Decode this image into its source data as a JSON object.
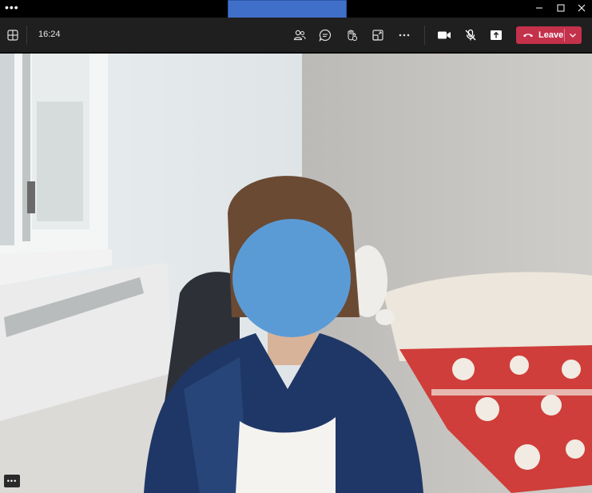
{
  "titlebar": {
    "menu_label": "•••"
  },
  "toolbar": {
    "clock": "16:24",
    "leave_label": "Leave",
    "leave_color": "#c4314b"
  },
  "video": {
    "more_label": "•••"
  },
  "icons": {
    "grid": "grid-icon",
    "participants": "people-icon",
    "chat": "chat-icon",
    "reactions": "raise-hand-icon",
    "rooms": "breakout-rooms-icon",
    "more": "more-icon",
    "camera": "camera-icon",
    "mic": "mic-off-icon",
    "share": "share-icon",
    "phone": "phone-icon",
    "chevron": "chevron-down-icon",
    "minimize": "minimize-icon",
    "maximize": "maximize-icon",
    "close": "close-icon"
  }
}
